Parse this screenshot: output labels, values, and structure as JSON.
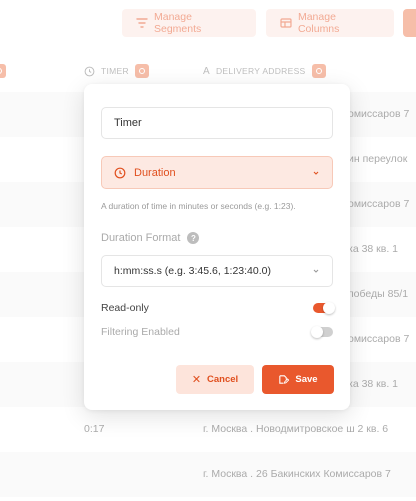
{
  "toolbar": {
    "manage_segments": "Manage Segments",
    "manage_columns": "Manage Columns"
  },
  "table": {
    "headers": {
      "timer": "TIMER",
      "delivery_address": "DELIVERY ADDRESS"
    },
    "rows": [
      {
        "time": "",
        "address": "омиссаров 7"
      },
      {
        "time": "",
        "address": "ин переулок"
      },
      {
        "time": "",
        "address": "омиссаров 7"
      },
      {
        "time": "",
        "address": "ка 38 кв. 1"
      },
      {
        "time": "",
        "address": "победы 85/1"
      },
      {
        "time": "",
        "address": "омиссаров 7"
      },
      {
        "time": "",
        "address": "ка 38 кв. 1"
      },
      {
        "time": "0:17",
        "address": "г. Москва . Новодмитровское ш 2 кв. 6"
      },
      {
        "time": "",
        "address": "г. Москва . 26 Бакинских Комиссаров 7"
      }
    ]
  },
  "modal": {
    "field_name_value": "Timer",
    "field_type": "Duration",
    "help_text": "A duration of time in minutes or seconds (e.g. 1:23).",
    "duration_format_label": "Duration Format",
    "duration_format_value": "h:mm:ss.s (e.g. 3:45.6, 1:23:40.0)",
    "read_only_label": "Read-only",
    "read_only_on": true,
    "filtering_label": "Filtering Enabled",
    "filtering_on": false,
    "cancel_label": "Cancel",
    "save_label": "Save"
  },
  "colors": {
    "accent": "#e9582d",
    "accent_light": "#fde9e2",
    "muted": "#9a9a9a"
  }
}
